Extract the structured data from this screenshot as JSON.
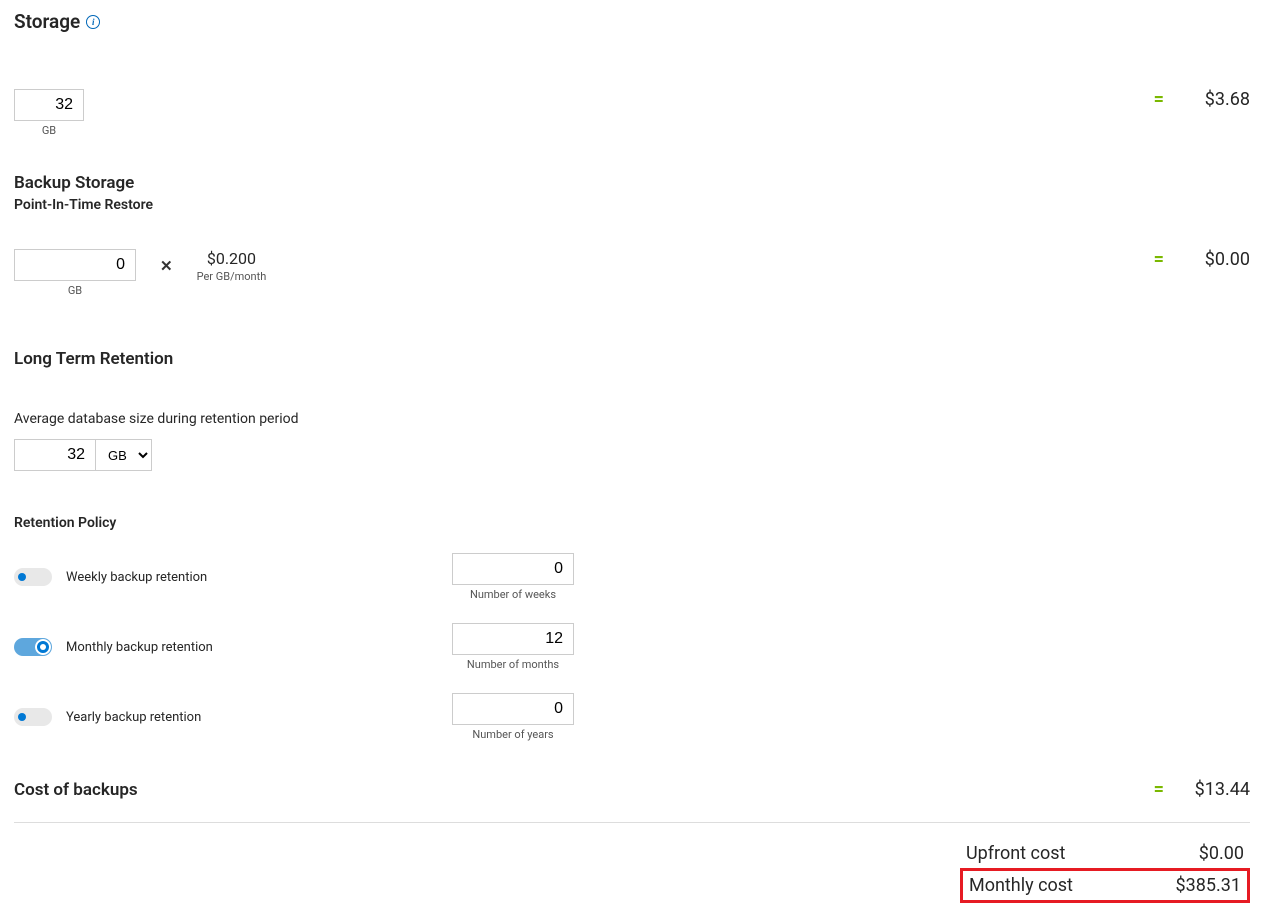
{
  "storage": {
    "title": "Storage",
    "value": "32",
    "unit": "GB",
    "eq": "=",
    "price": "$3.68"
  },
  "backup": {
    "title": "Backup Storage",
    "subtitle": "Point-In-Time Restore",
    "value": "0",
    "unit": "GB",
    "mult": "✕",
    "rate": "$0.200",
    "rate_sub": "Per GB/month",
    "eq": "=",
    "price": "$0.00"
  },
  "ltr": {
    "title": "Long Term Retention",
    "avg_label": "Average database size during retention period",
    "avg_value": "32",
    "avg_unit": "GB",
    "policy_label": "Retention Policy",
    "weekly": {
      "label": "Weekly backup retention",
      "value": "0",
      "caption": "Number of weeks",
      "on": false
    },
    "monthly": {
      "label": "Monthly backup retention",
      "value": "12",
      "caption": "Number of months",
      "on": true
    },
    "yearly": {
      "label": "Yearly backup retention",
      "value": "0",
      "caption": "Number of years",
      "on": false
    }
  },
  "cost_backups": {
    "label": "Cost of backups",
    "eq": "=",
    "price": "$13.44"
  },
  "totals": {
    "upfront_label": "Upfront cost",
    "upfront_value": "$0.00",
    "monthly_label": "Monthly cost",
    "monthly_value": "$385.31"
  }
}
